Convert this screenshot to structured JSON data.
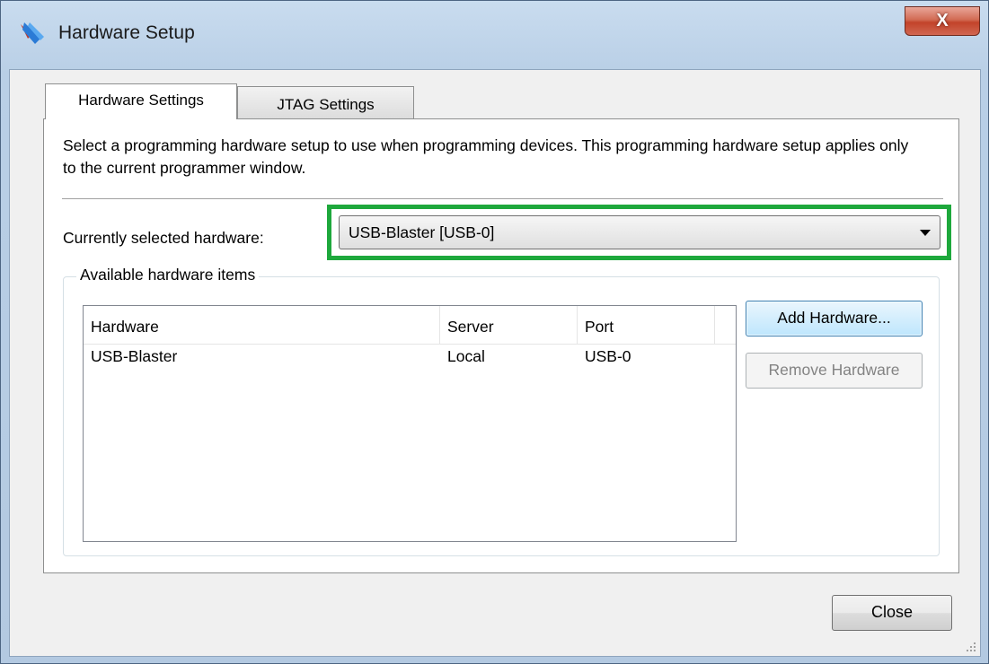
{
  "window": {
    "title": "Hardware Setup",
    "close_glyph": "X",
    "icon": "app-logo-icon"
  },
  "tabs": [
    {
      "label": "Hardware Settings",
      "active": true
    },
    {
      "label": "JTAG Settings",
      "active": false
    }
  ],
  "hardware_settings": {
    "description": "Select a programming hardware setup to use when programming devices. This programming hardware setup applies only to the current programmer window.",
    "selected_label": "Currently selected hardware:",
    "selected_value": "USB-Blaster [USB-0]",
    "available_group_label": "Available hardware items",
    "columns": [
      "Hardware",
      "Server",
      "Port"
    ],
    "rows": [
      {
        "hardware": "USB-Blaster",
        "server": "Local",
        "port": "USB-0"
      }
    ],
    "add_button": "Add Hardware...",
    "remove_button": "Remove Hardware"
  },
  "footer": {
    "close_button": "Close"
  },
  "colors": {
    "highlight": "#1ea83c",
    "accent_button": "#bee6fd",
    "disabled_text": "#838383"
  }
}
